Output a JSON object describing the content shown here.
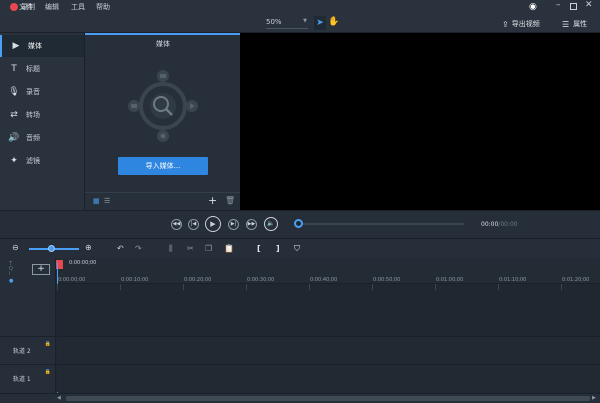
{
  "titlebar": {
    "record_label": "录制",
    "menu": [
      "文件",
      "编辑",
      "工具",
      "帮助"
    ]
  },
  "toolbar": {
    "zoom_value": "50%",
    "export_label": "导出视频",
    "properties_label": "属性"
  },
  "sidebar": {
    "items": [
      {
        "label": "媒体",
        "icon": "media-icon"
      },
      {
        "label": "标题",
        "icon": "title-icon"
      },
      {
        "label": "录音",
        "icon": "mic-icon"
      },
      {
        "label": "转场",
        "icon": "transition-icon"
      },
      {
        "label": "音频",
        "icon": "audio-icon"
      },
      {
        "label": "滤镜",
        "icon": "filter-icon"
      }
    ]
  },
  "media": {
    "header": "媒体",
    "import_label": "导入媒体..."
  },
  "playback": {
    "time_current": "00:00",
    "time_total": "/00:00"
  },
  "timeline": {
    "playhead_time": "0:00:00;00",
    "ticks": [
      "0:00:00;00",
      "0:00:10;00",
      "0:00:20;00",
      "0:00:30;00",
      "0:00:40;00",
      "0:00:50;00",
      "0:01:00;00",
      "0:01:10;00",
      "0:01:20;00"
    ],
    "tracks": [
      "轨道 2",
      "轨道 1"
    ]
  },
  "colors": {
    "accent": "#4a9ff5",
    "button": "#2f86e0",
    "record": "#e5484d"
  }
}
